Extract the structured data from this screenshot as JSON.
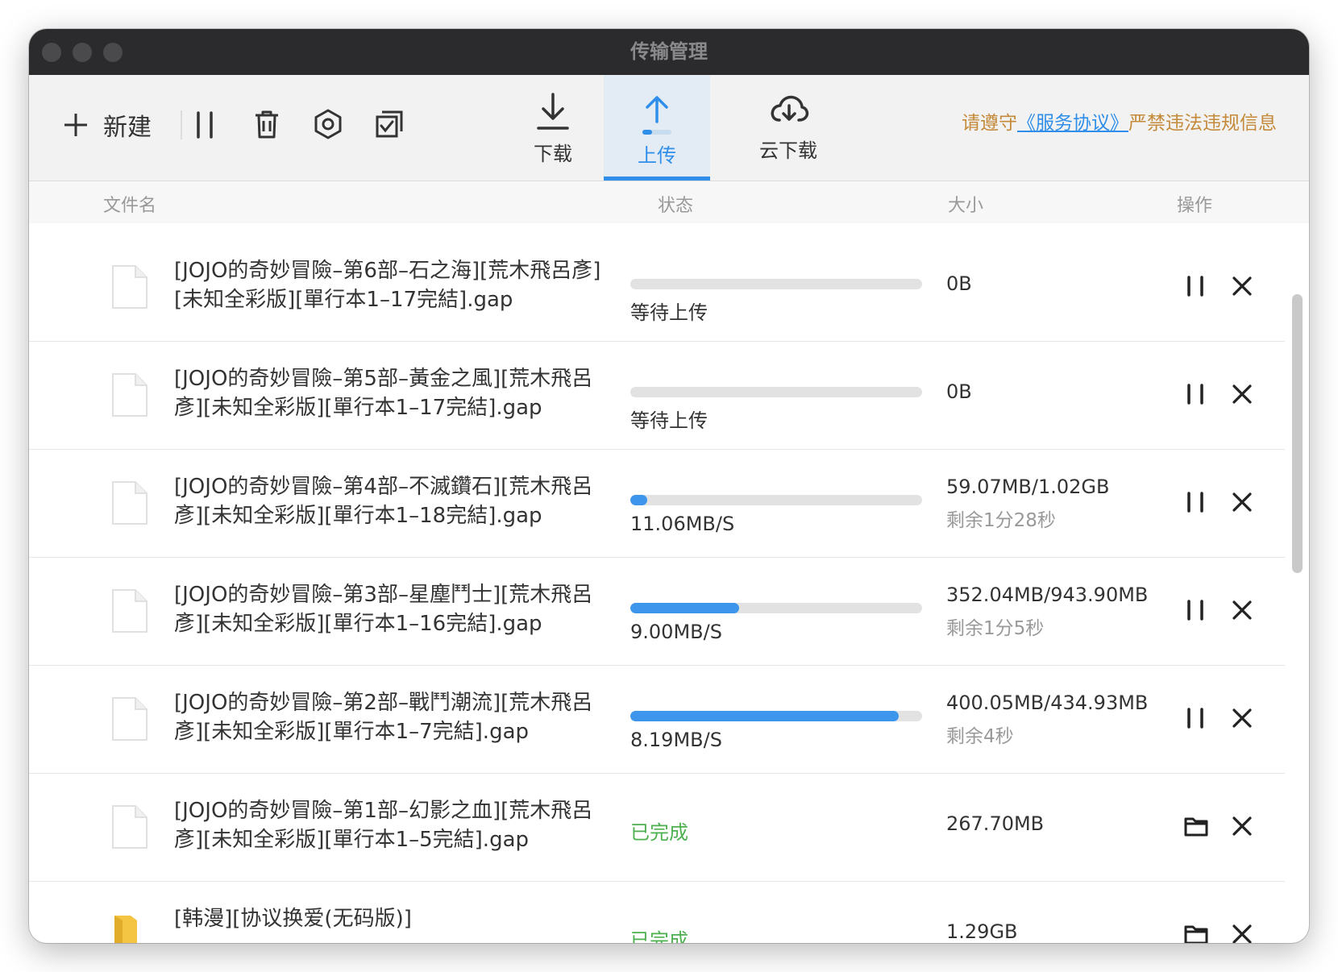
{
  "window": {
    "title": "传输管理"
  },
  "toolbar": {
    "new_label": "新建",
    "tabs": [
      {
        "label": "下载",
        "active": false
      },
      {
        "label": "上传",
        "active": true
      },
      {
        "label": "云下载",
        "active": false
      }
    ],
    "notice": {
      "prefix": "请遵守",
      "link": "《服务协议》",
      "suffix": "严禁违法违规信息"
    }
  },
  "columns": {
    "name": "文件名",
    "status": "状态",
    "size": "大小",
    "ops": "操作"
  },
  "rows": [
    {
      "name": "[JOJO的奇妙冒險–第6部–石之海][荒木飛呂彥][未知全彩版][單行本1–17完結].gap",
      "icon": "file-icon",
      "progress": 0,
      "status": "等待上传",
      "size": "0B",
      "remaining": "",
      "action": "pause-icon"
    },
    {
      "name": "[JOJO的奇妙冒險–第5部–黃金之風][荒木飛呂彥][未知全彩版][單行本1–17完結].gap",
      "icon": "file-icon",
      "progress": 0,
      "status": "等待上传",
      "size": "0B",
      "remaining": "",
      "action": "pause-icon"
    },
    {
      "name": "[JOJO的奇妙冒險–第4部–不滅鑽石][荒木飛呂彥][未知全彩版][單行本1–18完結].gap",
      "icon": "file-icon",
      "progress": 0.058,
      "status": "11.06MB/S",
      "size": "59.07MB/1.02GB",
      "remaining": "剩余1分28秒",
      "action": "pause-icon"
    },
    {
      "name": "[JOJO的奇妙冒險–第3部–星塵鬥士][荒木飛呂彥][未知全彩版][單行本1–16完結].gap",
      "icon": "file-icon",
      "progress": 0.373,
      "status": "9.00MB/S",
      "size": "352.04MB/943.90MB",
      "remaining": "剩余1分5秒",
      "action": "pause-icon"
    },
    {
      "name": "[JOJO的奇妙冒險–第2部–戰鬥潮流][荒木飛呂彥][未知全彩版][單行本1–7完結].gap",
      "icon": "file-icon",
      "progress": 0.92,
      "status": "8.19MB/S",
      "size": "400.05MB/434.93MB",
      "remaining": "剩余4秒",
      "action": "pause-icon"
    },
    {
      "name": "[JOJO的奇妙冒險–第1部–幻影之血][荒木飛呂彥][未知全彩版][單行本1–5完結].gap",
      "icon": "file-icon",
      "progress": 1,
      "status": "已完成",
      "size": "267.70MB",
      "remaining": "",
      "action": "folder-icon"
    },
    {
      "name": "[韩漫][协议换爱(无码版)]",
      "icon": "folder-icon",
      "progress": 1,
      "status": "已完成",
      "size": "1.29GB",
      "remaining": "",
      "action": "folder-icon"
    }
  ],
  "colors": {
    "accent": "#2e8ee9",
    "done": "#4cb04f",
    "notice": "#c48a3a"
  }
}
